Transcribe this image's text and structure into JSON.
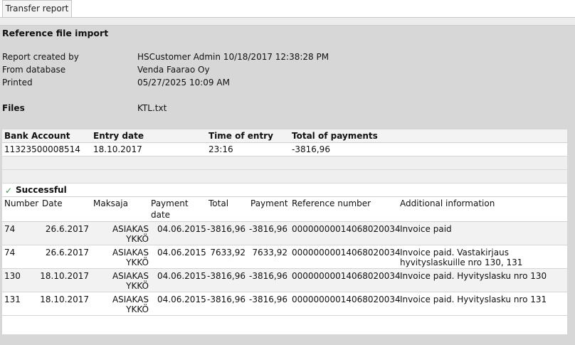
{
  "tab": {
    "label": "Transfer report"
  },
  "report": {
    "title": "Reference file import",
    "created_by_label": "Report created by",
    "created_by_value": "HSCustomer Admin 10/18/2017 12:38:28 PM",
    "database_label": "From database",
    "database_value": "Venda Faarao Oy",
    "printed_label": "Printed",
    "printed_value": "05/27/2025 10:09 AM",
    "files_label": "Files",
    "files_value": "KTL.txt"
  },
  "summary": {
    "headers": {
      "bank_account": "Bank Account",
      "entry_date": "Entry date",
      "time_of_entry": "Time of entry",
      "total_payments": "Total of payments"
    },
    "row": {
      "bank_account": "11323500008514",
      "entry_date": "18.10.2017",
      "time_of_entry": "23:16",
      "total_payments": "-3816,96"
    }
  },
  "successful": {
    "label": "Successful",
    "headers": {
      "number": "Number",
      "date": "Date",
      "maksaja": "Maksaja",
      "payment_date_1": "Payment",
      "payment_date_2": "date",
      "total": "Total",
      "payment": "Payment",
      "reference": "Reference number",
      "info": "Additional information"
    },
    "rows": [
      {
        "number": "74",
        "date": "26.6.2017",
        "payer1": "ASIAKAS",
        "payer2": "YKKÖ",
        "payment_date": "04.06.2015",
        "total": "-3816,96",
        "payment": "-3816,96",
        "reference": "00000000014068020034",
        "info1": "Invoice paid",
        "info2": ""
      },
      {
        "number": "74",
        "date": "26.6.2017",
        "payer1": "ASIAKAS",
        "payer2": "YKKÖ",
        "payment_date": "04.06.2015",
        "total": "7633,92",
        "payment": "7633,92",
        "reference": "00000000014068020034",
        "info1": "Invoice paid. Vastakirjaus",
        "info2": "hyvityslaskuille nro 130, 131"
      },
      {
        "number": "130",
        "date": "18.10.2017",
        "payer1": "ASIAKAS",
        "payer2": "YKKÖ",
        "payment_date": "04.06.2015",
        "total": "-3816,96",
        "payment": "-3816,96",
        "reference": "00000000014068020034",
        "info1": "Invoice paid. Hyvityslasku nro 130",
        "info2": ""
      },
      {
        "number": "131",
        "date": "18.10.2017",
        "payer1": "ASIAKAS",
        "payer2": "YKKÖ",
        "payment_date": "04.06.2015",
        "total": "-3816,96",
        "payment": "-3816,96",
        "reference": "00000000014068020034",
        "info1": "Invoice paid. Hyvityslasku nro 131",
        "info2": ""
      }
    ]
  }
}
